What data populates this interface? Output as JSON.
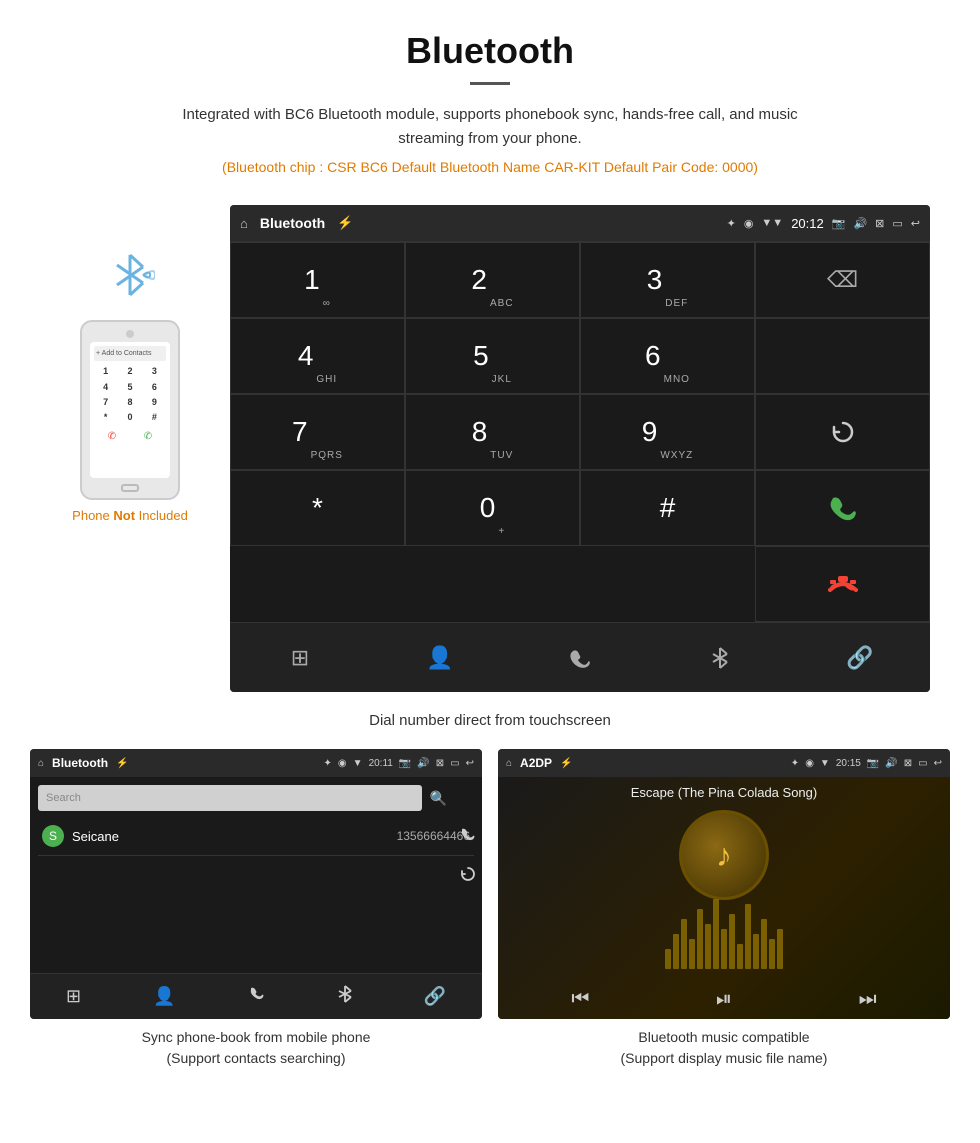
{
  "header": {
    "title": "Bluetooth",
    "description": "Integrated with BC6 Bluetooth module, supports phonebook sync, hands-free call, and music streaming from your phone.",
    "specs": "(Bluetooth chip : CSR BC6    Default Bluetooth Name CAR-KIT    Default Pair Code: 0000)"
  },
  "phone_mockup": {
    "label_orange": "Phone Not Included",
    "label_not": "Not"
  },
  "car_screen": {
    "topbar": {
      "left_icon": "⌂",
      "title": "Bluetooth",
      "usb_icon": "⚡",
      "status_icons": "✦ ◉ ▼",
      "time": "20:12",
      "right_icons": "📷 🔊 ⊠ ▭ ↩"
    },
    "dialpad": [
      {
        "num": "1",
        "sub": "∞",
        "col": 1
      },
      {
        "num": "2",
        "sub": "ABC",
        "col": 2
      },
      {
        "num": "3",
        "sub": "DEF",
        "col": 3
      },
      {
        "num": "",
        "sub": "",
        "col": 4,
        "type": "empty"
      },
      {
        "num": "4",
        "sub": "GHI",
        "col": 1
      },
      {
        "num": "5",
        "sub": "JKL",
        "col": 2
      },
      {
        "num": "6",
        "sub": "MNO",
        "col": 3
      },
      {
        "num": "",
        "sub": "",
        "col": 4,
        "type": "empty"
      },
      {
        "num": "7",
        "sub": "PQRS",
        "col": 1
      },
      {
        "num": "8",
        "sub": "TUV",
        "col": 2
      },
      {
        "num": "9",
        "sub": "WXYZ",
        "col": 3
      },
      {
        "num": "⟳",
        "sub": "",
        "col": 4,
        "type": "refresh"
      },
      {
        "num": "*",
        "sub": "",
        "col": 1
      },
      {
        "num": "0",
        "sub": "+",
        "col": 2
      },
      {
        "num": "#",
        "sub": "",
        "col": 3
      },
      {
        "num": "☎",
        "sub": "",
        "col": 4,
        "type": "green"
      },
      {
        "num": "⊘",
        "sub": "",
        "col": 4,
        "type": "red"
      }
    ],
    "bottom_nav": [
      "⊞",
      "👤",
      "☎",
      "✦",
      "🔗"
    ]
  },
  "dial_caption": "Dial number direct from touchscreen",
  "phonebook_screen": {
    "topbar_title": "Bluetooth",
    "topbar_time": "20:11",
    "search_placeholder": "Search",
    "contacts": [
      {
        "initial": "S",
        "name": "Seicane",
        "number": "13566664466"
      }
    ],
    "caption_line1": "Sync phone-book from mobile phone",
    "caption_line2": "(Support contacts searching)"
  },
  "music_screen": {
    "topbar_title": "A2DP",
    "topbar_time": "20:15",
    "song_title": "Escape (The Pina Colada Song)",
    "caption_line1": "Bluetooth music compatible",
    "caption_line2": "(Support display music file name)"
  }
}
